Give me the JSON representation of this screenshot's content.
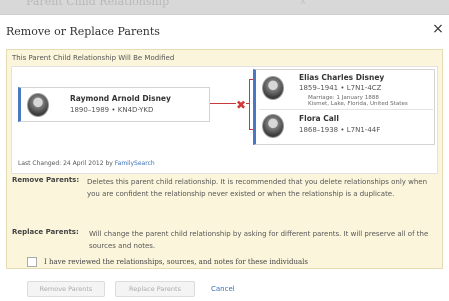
{
  "background": {
    "ghost_title": "Parent Child Relationship",
    "ghost_close": "x"
  },
  "dialog": {
    "title": "Remove or Replace Parents",
    "close_glyph": "×",
    "warning": "This Parent Child Relationship Will Be Modified",
    "child": {
      "name": "Raymond Arnold Disney",
      "lifespan": "1890–1989",
      "id": "KN4D-YKD"
    },
    "father": {
      "name": "Elias Charles Disney",
      "lifespan": "1859–1941",
      "id": "L7N1-4CZ"
    },
    "marriage": {
      "label": "Marriage: 1 January 1888",
      "place": "Kismet, Lake, Florida, United States"
    },
    "mother": {
      "name": "Flora Call",
      "lifespan": "1868–1938",
      "id": "L7N1-44F"
    },
    "last_changed": {
      "prefix": "Last Changed: 24 April 2012 by",
      "source": "FamilySearch"
    },
    "remove": {
      "label": "Remove Parents:",
      "text": "Deletes this parent child relationship. It is recommended that you delete relationships only when you are confident the relationship never existed or when the relationship is a duplicate."
    },
    "replace": {
      "label": "Replace Parents:",
      "text": "Will change the parent child relationship by asking for different parents. It will preserve all of the sources and notes."
    },
    "confirm_label": "I have reviewed the relationships, sources, and notes for these individuals",
    "buttons": {
      "remove": "Remove Parents",
      "replace": "Replace Parents",
      "cancel": "Cancel"
    },
    "colors": {
      "panel_bg": "#fbf5dc",
      "link": "#3a6fb8",
      "accent_blue": "#4a78c2",
      "remove_x": "#d23a3a"
    },
    "separator": "•"
  }
}
